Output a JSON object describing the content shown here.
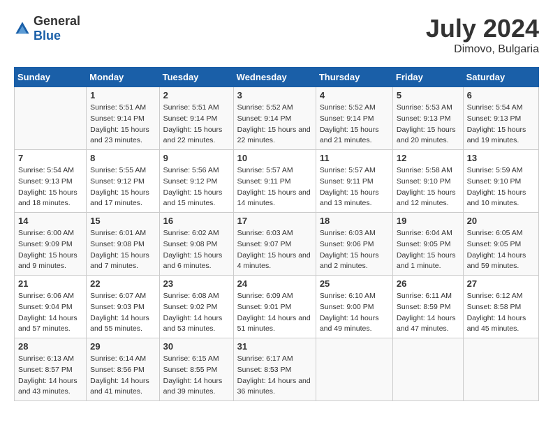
{
  "header": {
    "logo_general": "General",
    "logo_blue": "Blue",
    "title": "July 2024",
    "subtitle": "Dimovo, Bulgaria"
  },
  "days_of_week": [
    "Sunday",
    "Monday",
    "Tuesday",
    "Wednesday",
    "Thursday",
    "Friday",
    "Saturday"
  ],
  "weeks": [
    [
      {
        "day": "",
        "sunrise": "",
        "sunset": "",
        "daylight": ""
      },
      {
        "day": "1",
        "sunrise": "Sunrise: 5:51 AM",
        "sunset": "Sunset: 9:14 PM",
        "daylight": "Daylight: 15 hours and 23 minutes."
      },
      {
        "day": "2",
        "sunrise": "Sunrise: 5:51 AM",
        "sunset": "Sunset: 9:14 PM",
        "daylight": "Daylight: 15 hours and 22 minutes."
      },
      {
        "day": "3",
        "sunrise": "Sunrise: 5:52 AM",
        "sunset": "Sunset: 9:14 PM",
        "daylight": "Daylight: 15 hours and 22 minutes."
      },
      {
        "day": "4",
        "sunrise": "Sunrise: 5:52 AM",
        "sunset": "Sunset: 9:14 PM",
        "daylight": "Daylight: 15 hours and 21 minutes."
      },
      {
        "day": "5",
        "sunrise": "Sunrise: 5:53 AM",
        "sunset": "Sunset: 9:13 PM",
        "daylight": "Daylight: 15 hours and 20 minutes."
      },
      {
        "day": "6",
        "sunrise": "Sunrise: 5:54 AM",
        "sunset": "Sunset: 9:13 PM",
        "daylight": "Daylight: 15 hours and 19 minutes."
      }
    ],
    [
      {
        "day": "7",
        "sunrise": "Sunrise: 5:54 AM",
        "sunset": "Sunset: 9:13 PM",
        "daylight": "Daylight: 15 hours and 18 minutes."
      },
      {
        "day": "8",
        "sunrise": "Sunrise: 5:55 AM",
        "sunset": "Sunset: 9:12 PM",
        "daylight": "Daylight: 15 hours and 17 minutes."
      },
      {
        "day": "9",
        "sunrise": "Sunrise: 5:56 AM",
        "sunset": "Sunset: 9:12 PM",
        "daylight": "Daylight: 15 hours and 15 minutes."
      },
      {
        "day": "10",
        "sunrise": "Sunrise: 5:57 AM",
        "sunset": "Sunset: 9:11 PM",
        "daylight": "Daylight: 15 hours and 14 minutes."
      },
      {
        "day": "11",
        "sunrise": "Sunrise: 5:57 AM",
        "sunset": "Sunset: 9:11 PM",
        "daylight": "Daylight: 15 hours and 13 minutes."
      },
      {
        "day": "12",
        "sunrise": "Sunrise: 5:58 AM",
        "sunset": "Sunset: 9:10 PM",
        "daylight": "Daylight: 15 hours and 12 minutes."
      },
      {
        "day": "13",
        "sunrise": "Sunrise: 5:59 AM",
        "sunset": "Sunset: 9:10 PM",
        "daylight": "Daylight: 15 hours and 10 minutes."
      }
    ],
    [
      {
        "day": "14",
        "sunrise": "Sunrise: 6:00 AM",
        "sunset": "Sunset: 9:09 PM",
        "daylight": "Daylight: 15 hours and 9 minutes."
      },
      {
        "day": "15",
        "sunrise": "Sunrise: 6:01 AM",
        "sunset": "Sunset: 9:08 PM",
        "daylight": "Daylight: 15 hours and 7 minutes."
      },
      {
        "day": "16",
        "sunrise": "Sunrise: 6:02 AM",
        "sunset": "Sunset: 9:08 PM",
        "daylight": "Daylight: 15 hours and 6 minutes."
      },
      {
        "day": "17",
        "sunrise": "Sunrise: 6:03 AM",
        "sunset": "Sunset: 9:07 PM",
        "daylight": "Daylight: 15 hours and 4 minutes."
      },
      {
        "day": "18",
        "sunrise": "Sunrise: 6:03 AM",
        "sunset": "Sunset: 9:06 PM",
        "daylight": "Daylight: 15 hours and 2 minutes."
      },
      {
        "day": "19",
        "sunrise": "Sunrise: 6:04 AM",
        "sunset": "Sunset: 9:05 PM",
        "daylight": "Daylight: 15 hours and 1 minute."
      },
      {
        "day": "20",
        "sunrise": "Sunrise: 6:05 AM",
        "sunset": "Sunset: 9:05 PM",
        "daylight": "Daylight: 14 hours and 59 minutes."
      }
    ],
    [
      {
        "day": "21",
        "sunrise": "Sunrise: 6:06 AM",
        "sunset": "Sunset: 9:04 PM",
        "daylight": "Daylight: 14 hours and 57 minutes."
      },
      {
        "day": "22",
        "sunrise": "Sunrise: 6:07 AM",
        "sunset": "Sunset: 9:03 PM",
        "daylight": "Daylight: 14 hours and 55 minutes."
      },
      {
        "day": "23",
        "sunrise": "Sunrise: 6:08 AM",
        "sunset": "Sunset: 9:02 PM",
        "daylight": "Daylight: 14 hours and 53 minutes."
      },
      {
        "day": "24",
        "sunrise": "Sunrise: 6:09 AM",
        "sunset": "Sunset: 9:01 PM",
        "daylight": "Daylight: 14 hours and 51 minutes."
      },
      {
        "day": "25",
        "sunrise": "Sunrise: 6:10 AM",
        "sunset": "Sunset: 9:00 PM",
        "daylight": "Daylight: 14 hours and 49 minutes."
      },
      {
        "day": "26",
        "sunrise": "Sunrise: 6:11 AM",
        "sunset": "Sunset: 8:59 PM",
        "daylight": "Daylight: 14 hours and 47 minutes."
      },
      {
        "day": "27",
        "sunrise": "Sunrise: 6:12 AM",
        "sunset": "Sunset: 8:58 PM",
        "daylight": "Daylight: 14 hours and 45 minutes."
      }
    ],
    [
      {
        "day": "28",
        "sunrise": "Sunrise: 6:13 AM",
        "sunset": "Sunset: 8:57 PM",
        "daylight": "Daylight: 14 hours and 43 minutes."
      },
      {
        "day": "29",
        "sunrise": "Sunrise: 6:14 AM",
        "sunset": "Sunset: 8:56 PM",
        "daylight": "Daylight: 14 hours and 41 minutes."
      },
      {
        "day": "30",
        "sunrise": "Sunrise: 6:15 AM",
        "sunset": "Sunset: 8:55 PM",
        "daylight": "Daylight: 14 hours and 39 minutes."
      },
      {
        "day": "31",
        "sunrise": "Sunrise: 6:17 AM",
        "sunset": "Sunset: 8:53 PM",
        "daylight": "Daylight: 14 hours and 36 minutes."
      },
      {
        "day": "",
        "sunrise": "",
        "sunset": "",
        "daylight": ""
      },
      {
        "day": "",
        "sunrise": "",
        "sunset": "",
        "daylight": ""
      },
      {
        "day": "",
        "sunrise": "",
        "sunset": "",
        "daylight": ""
      }
    ]
  ]
}
